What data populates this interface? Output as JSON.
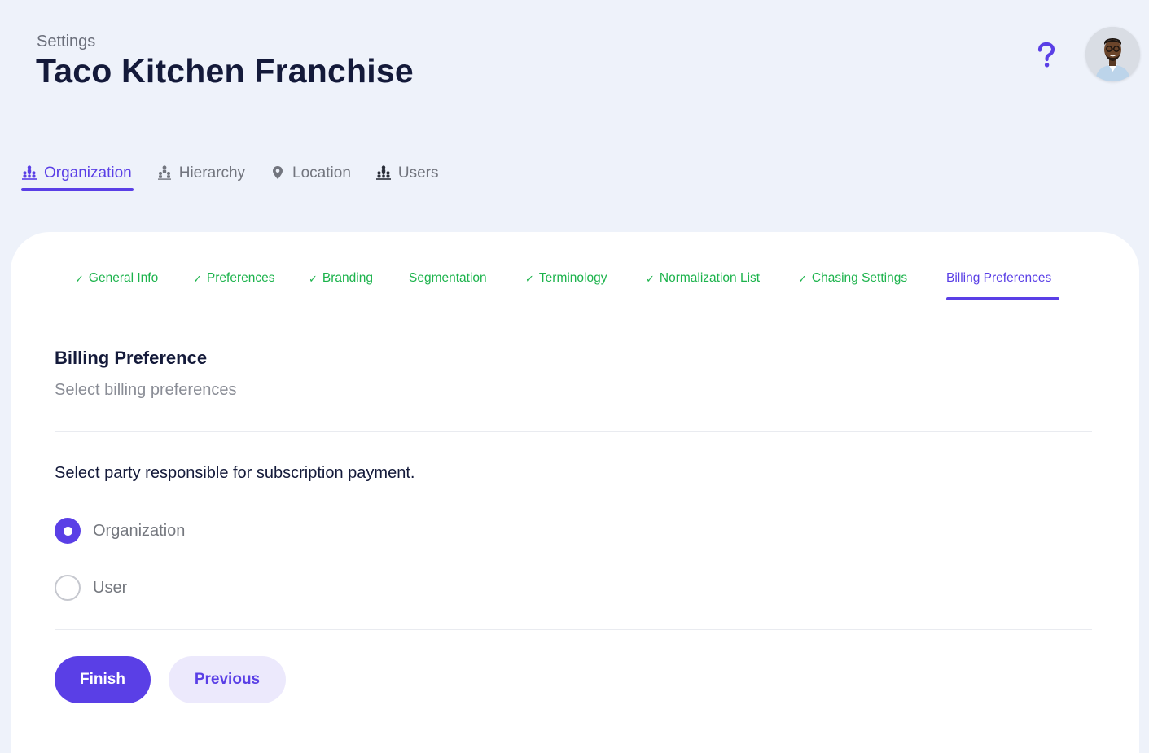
{
  "header": {
    "breadcrumb": "Settings",
    "title": "Taco Kitchen Franchise",
    "help_icon": "question-mark-icon",
    "avatar_icon": "user-avatar"
  },
  "main_tabs": [
    {
      "label": "Organization",
      "icon": "organization-icon",
      "active": true
    },
    {
      "label": "Hierarchy",
      "icon": "hierarchy-icon",
      "active": false
    },
    {
      "label": "Location",
      "icon": "location-pin-icon",
      "active": false
    },
    {
      "label": "Users",
      "icon": "users-icon",
      "active": false
    }
  ],
  "sub_tabs": [
    {
      "label": "General Info",
      "completed": true
    },
    {
      "label": "Preferences",
      "completed": true
    },
    {
      "label": "Branding",
      "completed": true
    },
    {
      "label": "Segmentation",
      "completed": false
    },
    {
      "label": "Terminology",
      "completed": true
    },
    {
      "label": "Normalization List",
      "completed": true
    },
    {
      "label": "Chasing Settings",
      "completed": true
    },
    {
      "label": "Billing Preferences",
      "completed": false,
      "active": true
    }
  ],
  "check_glyph": "✓",
  "billing": {
    "title": "Billing Preference",
    "subtitle": "Select billing preferences",
    "question": "Select party responsible for subscription payment.",
    "options": [
      {
        "label": "Organization",
        "selected": true
      },
      {
        "label": "User",
        "selected": false
      }
    ]
  },
  "actions": {
    "finish_label": "Finish",
    "previous_label": "Previous"
  },
  "colors": {
    "accent": "#5a3fe6",
    "completed": "#1cb34c",
    "background": "#eef2fa",
    "title": "#141a3a"
  }
}
